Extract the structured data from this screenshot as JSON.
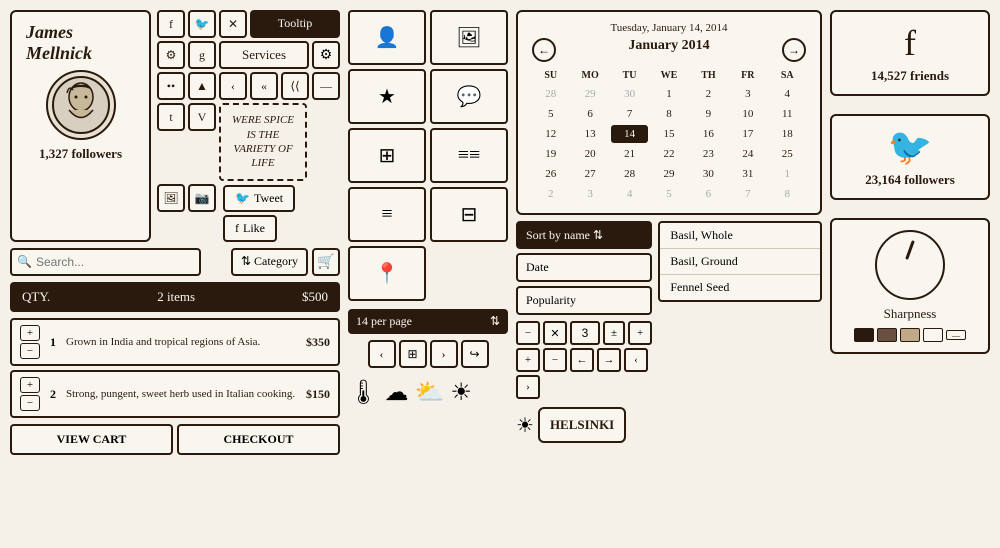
{
  "profile": {
    "name": "James Mellnick",
    "followers_count": "1,327",
    "followers_label": "followers"
  },
  "tooltip": {
    "label": "Tooltip"
  },
  "services": {
    "label": "Services"
  },
  "dashed_text": {
    "content": "WERE SPICE IS THE VARIETY OF LIFE"
  },
  "social_actions": {
    "tweet": "Tweet",
    "like": "Like"
  },
  "search": {
    "placeholder": "Search...",
    "category": "Category"
  },
  "cart": {
    "qty_label": "QTY.",
    "items_count": "2 items",
    "total": "$500",
    "item1_num": "1",
    "item1_desc": "Grown in India and tropical regions of Asia.",
    "item1_price": "$350",
    "item2_num": "2",
    "item2_desc": "Strong, pungent, sweet herb used in Italian cooking.",
    "item2_price": "$150",
    "view_cart": "VIEW CART",
    "checkout": "CHECKOUT"
  },
  "calendar": {
    "date_label": "Tuesday, January 14, 2014",
    "month_label": "January 2014",
    "days": [
      "SU",
      "MO",
      "TU",
      "WE",
      "TH",
      "FR",
      "SA"
    ],
    "weeks": [
      [
        "28",
        "29",
        "30",
        "1",
        "2",
        "3",
        "4"
      ],
      [
        "5",
        "6",
        "7",
        "8",
        "9",
        "10",
        "11"
      ],
      [
        "12",
        "13",
        "14",
        "15",
        "16",
        "17",
        "18"
      ],
      [
        "19",
        "20",
        "21",
        "22",
        "23",
        "24",
        "25"
      ],
      [
        "26",
        "27",
        "28",
        "29",
        "30",
        "31",
        "1"
      ],
      [
        "2",
        "3",
        "4",
        "5",
        "6",
        "7",
        "8"
      ]
    ],
    "today": "14"
  },
  "sort": {
    "label": "Sort by name",
    "options": [
      "Sort by name",
      "Date",
      "Popularity"
    ]
  },
  "filter_options": [
    "Date",
    "Popularity"
  ],
  "spices": [
    "Basil, Whole",
    "Basil, Ground",
    "Fennel Seed"
  ],
  "per_page": {
    "label": "14 per page"
  },
  "sharpness": {
    "label": "Sharpness"
  },
  "facebook": {
    "count": "14,527",
    "label": "friends"
  },
  "twitter": {
    "count": "23,164",
    "label": "followers"
  },
  "helsinki": {
    "label": "HELSINKI"
  },
  "controls": {
    "number_value": "3"
  },
  "colors": {
    "dark": "#2a1a0e",
    "light": "#f9f5ef",
    "bg": "#f5f0e8"
  }
}
